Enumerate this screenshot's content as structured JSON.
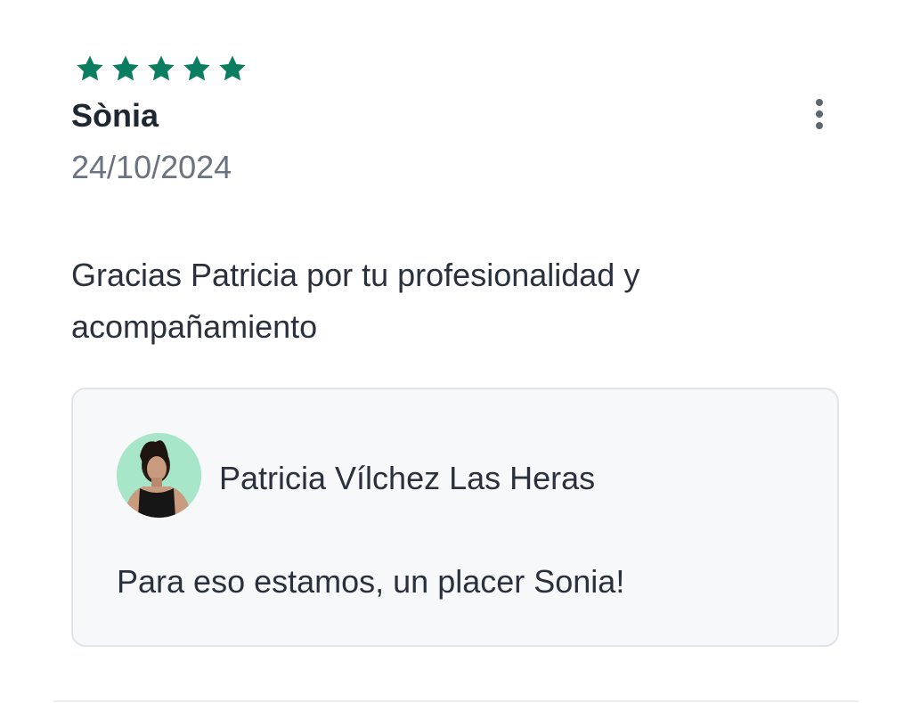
{
  "review": {
    "rating": 5,
    "rating_max": 5,
    "star_color": "#0b7e62",
    "reviewer_name": "Sònia",
    "date": "24/10/2024",
    "text": "Gracias Patricia por tu profesionalidad y acompañamiento",
    "menu_icon": "more-vertical-icon"
  },
  "reply": {
    "author_name": "Patricia Vílchez Las Heras",
    "avatar_background": "#a8e6c9",
    "text": "Para eso estamos, un placer Sonia!"
  }
}
